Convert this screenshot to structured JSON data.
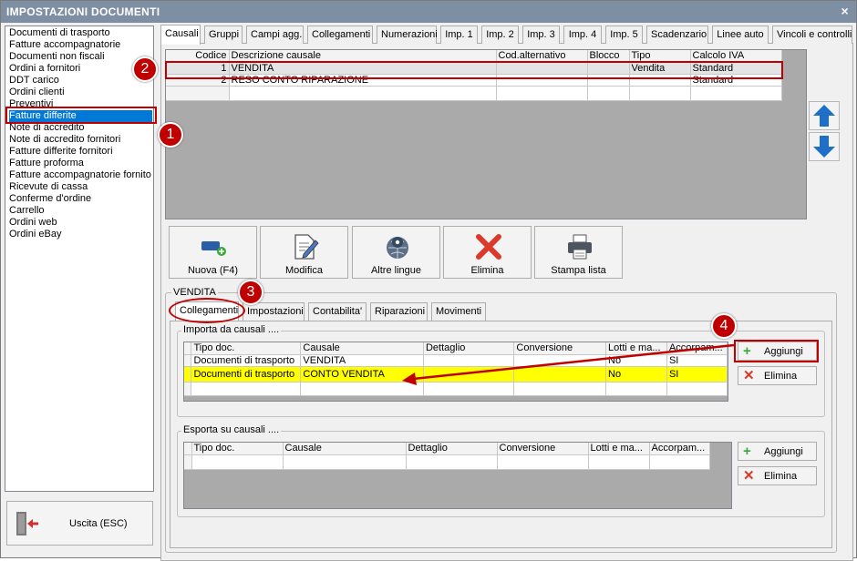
{
  "window": {
    "title": "IMPOSTAZIONI DOCUMENTI",
    "close_glyph": "×"
  },
  "doc_list": [
    "Documenti di trasporto",
    "Fatture accompagnatorie",
    "Documenti non fiscali",
    "Ordini a fornitori",
    "DDT carico",
    "Ordini clienti",
    "Preventivi",
    "Fatture differite",
    "Note di accredito",
    "Note di accredito fornitori",
    "Fatture differite fornitori",
    "Fatture proforma",
    "Fatture accompagnatorie fornito",
    "Ricevute di cassa",
    "Conferme d'ordine",
    "Carrello",
    "Ordini web",
    "Ordini eBay"
  ],
  "exit_button": {
    "label": "Uscita (ESC)",
    "icon": "exit-door-icon"
  },
  "top_tabs": [
    "Causali",
    "Gruppi",
    "Campi agg.",
    "Collegamenti",
    "Numerazioni",
    "Imp. 1",
    "Imp. 2",
    "Imp. 3",
    "Imp. 4",
    "Imp. 5",
    "Scadenzario",
    "Linee auto",
    "Vincoli e controlli"
  ],
  "causali_grid": {
    "columns": [
      "Codice",
      "Descrizione causale",
      "Cod.alternativo",
      "Blocco",
      "Tipo",
      "Calcolo IVA"
    ],
    "rows": [
      [
        "1",
        "VENDITA",
        "",
        "",
        "Vendita",
        "Standard"
      ],
      [
        "2",
        "RESO CONTO RIPARAZIONE",
        "",
        "",
        "",
        "Standard"
      ]
    ]
  },
  "toolbar": {
    "new_label": "Nuova (F4)",
    "edit_label": "Modifica",
    "languages_label": "Altre lingue",
    "delete_label": "Elimina",
    "print_label": "Stampa lista"
  },
  "detail": {
    "group_title": "VENDITA",
    "tabs": [
      "Collegamenti",
      "Impostazioni",
      "Contabilita'",
      "Riparazioni",
      "Movimenti"
    ],
    "import_section": {
      "title": "Importa da causali ....",
      "columns": [
        "Tipo doc.",
        "Causale",
        "Dettaglio",
        "Conversione",
        "Lotti e ma...",
        "Accorpam..."
      ],
      "rows": [
        [
          "Documenti di trasporto",
          "VENDITA",
          "",
          "",
          "No",
          "SI"
        ],
        [
          "Documenti di trasporto",
          "CONTO VENDITA",
          "",
          "",
          "No",
          "SI"
        ]
      ],
      "add_label": "Aggiungi",
      "delete_label": "Elimina"
    },
    "export_section": {
      "title": "Esporta su causali ....",
      "columns": [
        "Tipo doc.",
        "Causale",
        "Dettaglio",
        "Conversione",
        "Lotti e ma...",
        "Accorpam..."
      ],
      "rows": [],
      "add_label": "Aggiungi",
      "delete_label": "Elimina"
    }
  },
  "callouts": [
    "1",
    "2",
    "3",
    "4"
  ],
  "colors": {
    "accent_red": "#c00000",
    "highlight_yellow": "#ffff00",
    "selection_blue": "#0078d7",
    "title_bar": "#7f8fa3"
  }
}
